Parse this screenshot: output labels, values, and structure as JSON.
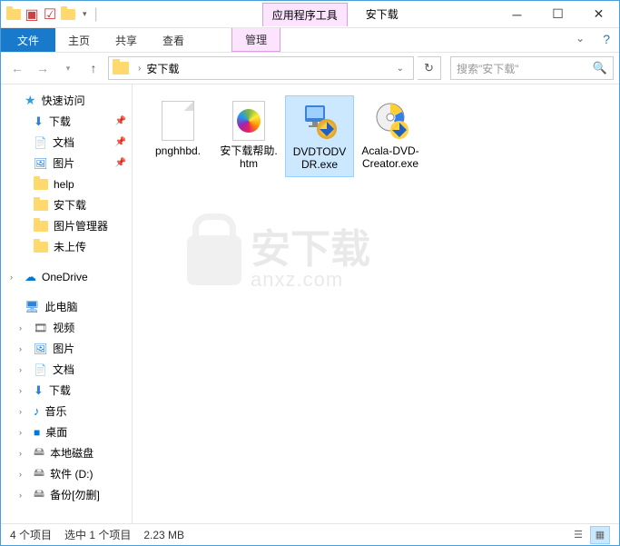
{
  "title": "安下载",
  "tool_tab": "应用程序工具",
  "ribbon": {
    "file": "文件",
    "home": "主页",
    "share": "共享",
    "view": "查看",
    "manage": "管理"
  },
  "breadcrumb": {
    "current": "安下载"
  },
  "search_placeholder": "搜索\"安下载\"",
  "sidebar": {
    "quick": "快速访问",
    "items": [
      {
        "label": "下载",
        "pin": true
      },
      {
        "label": "文档",
        "pin": true
      },
      {
        "label": "图片",
        "pin": true
      },
      {
        "label": "help",
        "pin": false
      },
      {
        "label": "安下载",
        "pin": false
      },
      {
        "label": "图片管理器",
        "pin": false
      },
      {
        "label": "未上传",
        "pin": false
      }
    ],
    "onedrive": "OneDrive",
    "thispc": "此电脑",
    "pc_items": [
      {
        "label": "视频"
      },
      {
        "label": "图片"
      },
      {
        "label": "文档"
      },
      {
        "label": "下载"
      },
      {
        "label": "音乐"
      },
      {
        "label": "桌面"
      },
      {
        "label": "本地磁盘"
      },
      {
        "label": "软件 (D:)"
      },
      {
        "label": "备份[勿删]"
      }
    ]
  },
  "files": [
    {
      "name": "pnghhbd.",
      "icon": "blank",
      "selected": false
    },
    {
      "name": "安下载帮助.htm",
      "icon": "htm",
      "selected": false
    },
    {
      "name": "DVDTODVDR.exe",
      "icon": "exe1",
      "selected": true
    },
    {
      "name": "Acala-DVD-Creator.exe",
      "icon": "exe2",
      "selected": false
    }
  ],
  "watermark": {
    "cn": "安下载",
    "en": "anxz.com"
  },
  "status": {
    "count": "4 个项目",
    "selected": "选中 1 个项目",
    "size": "2.23 MB"
  }
}
